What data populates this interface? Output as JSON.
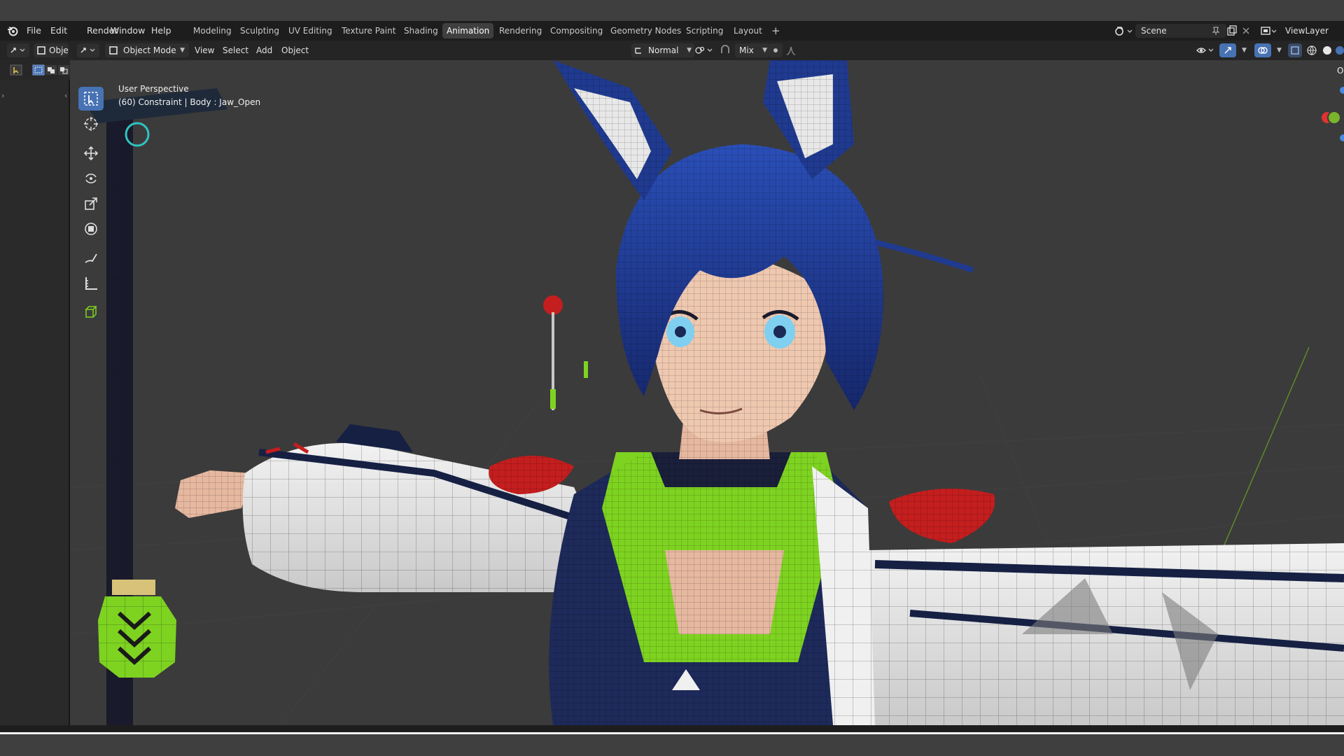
{
  "menu": {
    "file": "File",
    "edit": "Edit",
    "render": "Render",
    "window": "Window",
    "help": "Help"
  },
  "workspaces": [
    {
      "label": "Modeling",
      "active": false
    },
    {
      "label": "Sculpting",
      "active": false
    },
    {
      "label": "UV Editing",
      "active": false
    },
    {
      "label": "Texture Paint",
      "active": false
    },
    {
      "label": "Shading",
      "active": false
    },
    {
      "label": "Animation",
      "active": true
    },
    {
      "label": "Rendering",
      "active": false
    },
    {
      "label": "Compositing",
      "active": false
    },
    {
      "label": "Geometry Nodes",
      "active": false
    },
    {
      "label": "Scripting",
      "active": false
    },
    {
      "label": "Layout",
      "active": false
    }
  ],
  "add_workspace": "+",
  "scene_name": "Scene",
  "view_layer": "ViewLayer",
  "left_editor": {
    "mode_label": "Obje"
  },
  "viewport_header": {
    "mode": "Object Mode",
    "view": "View",
    "select": "Select",
    "add": "Add",
    "object": "Object",
    "orientation": "Normal",
    "proportional": "Mix"
  },
  "viewport_info": {
    "perspective": "User Perspective",
    "context": "(60) Constraint | Body : Jaw_Open"
  },
  "right_clip_text": "O",
  "tools": [
    {
      "icon": "select-box-icon",
      "active": true
    },
    {
      "icon": "cursor-icon",
      "active": false
    },
    {
      "icon": "move-icon",
      "active": false
    },
    {
      "icon": "rotate-icon",
      "active": false
    },
    {
      "icon": "scale-icon",
      "active": false
    },
    {
      "icon": "transform-icon",
      "active": false
    },
    {
      "icon": "annotate-icon",
      "active": false
    },
    {
      "icon": "measure-icon",
      "active": false
    },
    {
      "icon": "add-cube-icon",
      "active": false
    }
  ],
  "colors": {
    "accent": "#4772b3",
    "header_bg": "#1d1d1d",
    "viewport_bg": "#3b3b3b",
    "hair_blue": "#1f3a8f",
    "outfit_green": "#7ed321",
    "ribbon_red": "#c41e1e"
  }
}
